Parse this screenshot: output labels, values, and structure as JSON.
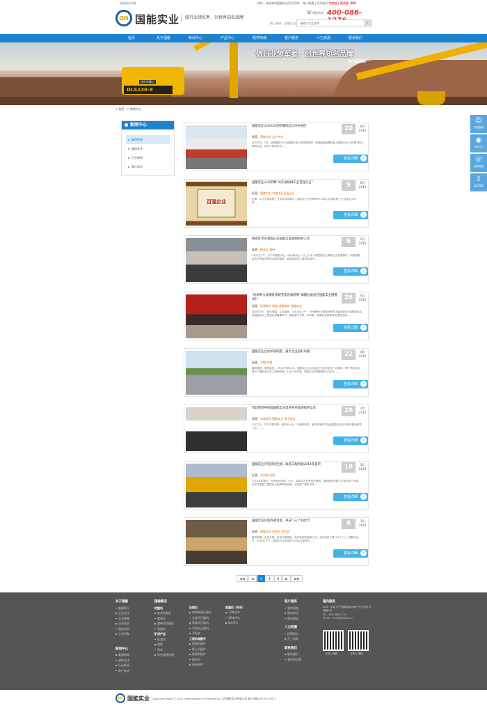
{
  "topbar": {
    "left": "钢筋服务网络",
    "right_prefix": "你好，欢迎来到国能实业官方网站！",
    "right_links": "加入收藏 | 设为首页",
    "lang": "中文站 | 英文站（EN）"
  },
  "header": {
    "logo_mark": "GN",
    "logo_text": "国能实业",
    "slogan": "做行业领军者，创世界知名品牌",
    "phone_label": "销售热线",
    "phone": "400-086-1276",
    "hot_keywords": "热门关键：压路机 叉车",
    "search_placeholder": "请输入产品名称",
    "search_icon": "search-icon"
  },
  "nav": [
    "首页",
    "关于国能",
    "新闻中心",
    "产品中心",
    "配件商城",
    "客户服务",
    "人力资源",
    "联系我们"
  ],
  "banner": {
    "title": "做行业领军者，创世界知名品牌",
    "brand": "WOLWA",
    "plate": "DLS130-9",
    "cab_label": "沃尔华重工"
  },
  "breadcrumb": {
    "home": "首页",
    "sep": "-->",
    "current": "新闻中心"
  },
  "sidebar": {
    "title": "新闻中心",
    "items": [
      "集团新闻",
      "媒体关注",
      "行业新闻",
      "客户来访"
    ],
    "active": 0
  },
  "news": [
    {
      "title": "国能实业公司320台挖掘机出口中东地区",
      "tag_label": "标签：",
      "tags": "国能实业 出口中东",
      "summary": "6月20日，5日，我国首批320台国能实业公司挖掘机的一批满装集装箱货轮从国能实业公司港口码头顺利出发，发往沙特阿拉伯……",
      "day": "20",
      "month": "6月",
      "year": "2014",
      "more": "查看详细"
    },
    {
      "title": "国能实业公司荣膺“山东省机械工业百强企业”",
      "tag_label": "标签：",
      "tags": "国能实业 机械工业百强企业",
      "summary": "近期，从山东省机械工业协会传来喜讯：国能实业公司荣获2013年山东省机械工业百强企业称号……",
      "day": "9",
      "month": "6月",
      "year": "2014",
      "more": "查看详细"
    },
    {
      "title": "梅永红市长到临山东国能实业调研指导工作",
      "tag_label": "标签：",
      "tags": "梅永红 调研",
      "summary": "5月2日下午，济宁市委副书记、市长梅永红一行三十余人到国能实业调研企业发展情况，市委常委、副市长宫晓芳等同志陪同调研，县委县政府主要领导陪同……",
      "day": "6",
      "month": "5月",
      "year": "2014",
      "more": "查看详细"
    },
    {
      "title": "“防滑骨头关键技术研究及装备研制”课题验收会在国能实业隆重举行",
      "tag_label": "标签：",
      "tags": "防滑骨头 装备 课题验收 国能实业",
      "summary": "四月的济宁，春光明媚，生机盎然。4月28日上午，“防滑骨头关键技术研究及装备研制”课题验收会在国能实业三楼会议室隆重举行，国家部门专家、市科委、国家科技部等有关领导出席……",
      "day": "28",
      "month": "4月",
      "year": "2014",
      "more": "查看详细"
    },
    {
      "title": "国能实业启动早操制度，展示企业良好风貌",
      "tag_label": "标签：",
      "tags": "早操 风貌",
      "summary": "春风拂煦，春意盎然。4月22日早8:00，国能实业公司全体员工准时到达厂区操场，举行早操活动，展示了国能实业员工精神风貌，4月22日开始，国能实业早操制度正式启动……",
      "day": "22",
      "month": "4月",
      "year": "2014",
      "more": "查看详细"
    },
    {
      "title": "市政府领导莅临国能实业电子商务基地指导工作",
      "tag_label": "标签：",
      "tags": "市政领导 国能实业 电子商务",
      "summary": "3月27日，济宁市委常委、副市长一行，市政府常委、副市长等同志莅临国能实业电子商务基地指导工作，……",
      "day": "28",
      "month": "3月",
      "year": "2014",
      "more": "查看详细"
    },
    {
      "title": "国能实业外贸部创佳绩，收获工程机械2014年良单",
      "tag_label": "标签：",
      "tags": "外贸部 佳绩",
      "summary": "2014年的春天，外贸部创佳绩，近日，国能实业外贸部在美国、德国等国的客户中拿到多个大单，这不仅增加了国能实业品牌的知名度，也巩固了国际市场……",
      "day": "18",
      "month": "3月",
      "year": "2014",
      "more": "查看详细"
    },
    {
      "title": "国能实业外贸办茶话会，共庆“三八”妇女节",
      "tag_label": "标签：",
      "tags": "国能实业 妇女节 茶话会",
      "summary": "春风送暖，百花争艳，在这万象更新、生机勃勃的美丽三月，我们迎来了第104个“三八”国际妇女节，3月8日下午，国能实业外贸部在公司会议室举办……",
      "day": "8",
      "month": "3月",
      "year": "2014",
      "more": "查看详细"
    }
  ],
  "pager": [
    "◄◄",
    "◄",
    "1",
    "2",
    "3",
    "►",
    "►►"
  ],
  "pager_active": 2,
  "float_bar": [
    {
      "icon": "user-icon",
      "glyph": "☺",
      "label": "在线咨询"
    },
    {
      "icon": "qq-icon",
      "glyph": "◉",
      "label": "企业QQ"
    },
    {
      "icon": "phone-icon",
      "glyph": "☏",
      "label": "咨询热线"
    },
    {
      "icon": "top-icon",
      "glyph": "⇧",
      "label": "返回顶部"
    }
  ],
  "footer": {
    "about": {
      "title": "关于国能",
      "items": [
        "集团简介",
        "企业文化",
        "企业荣誉",
        "企业资质",
        "组织机构",
        "企业形象"
      ]
    },
    "news": {
      "title": "新闻中心",
      "items": [
        "集团新闻",
        "媒体关注",
        "行业新闻",
        "客户来访"
      ]
    },
    "products": {
      "title": "国能概况",
      "c1": {
        "h": "挖掘机",
        "items": [
          "轮式挖掘机",
          "履带式",
          "履带式挖掘机",
          "装载机"
        ]
      },
      "c1b": {
        "h": "矿用产品",
        "items": [
          "扒渣机",
          "煤管",
          "顶车",
          "综合采掘设备"
        ]
      },
      "c2": {
        "h": "压路机",
        "items": [
          "单钢单驱压路机",
          "全液压压路机",
          "驾驶式压路机",
          "手扶式压路机",
          "平板夯"
        ]
      },
      "c2b": {
        "h": "工程机械配件",
        "items": [
          "挖掘机配件",
          "推土机配件",
          "装载机配件",
          "随车吊",
          "液压配件"
        ]
      },
      "c3": {
        "h": "起重机（吊车）",
        "items": [
          "12吨吊车",
          "16吨吊车",
          "8吨吊车"
        ]
      }
    },
    "service": {
      "title": "客户服务",
      "items": [
        "服务网络",
        "服务承诺",
        "服务理念"
      ]
    },
    "hr": {
      "title": "人力资源",
      "items": [
        "招聘职位",
        "员工风采"
      ]
    },
    "contact": {
      "title": "联系我们",
      "items": [
        "联系我们",
        "我们的位置"
      ]
    },
    "company": {
      "title": "国内服务",
      "lines": [
        "Add：中国 济宁国家高新技术产业开发区山海路3号",
        "Tel：400-086-1276",
        "Email：trade@wolwa.cn"
      ],
      "qr1": "手机二维码",
      "qr2": "手机二维码"
    }
  },
  "copyright": {
    "logo_mark": "GN",
    "logo_text": "国能实业",
    "text": "Copyright Right © 2014 www.wolwa.cn Powered By 山东国能实业有限公司 鲁ICP备14005742号-1"
  }
}
